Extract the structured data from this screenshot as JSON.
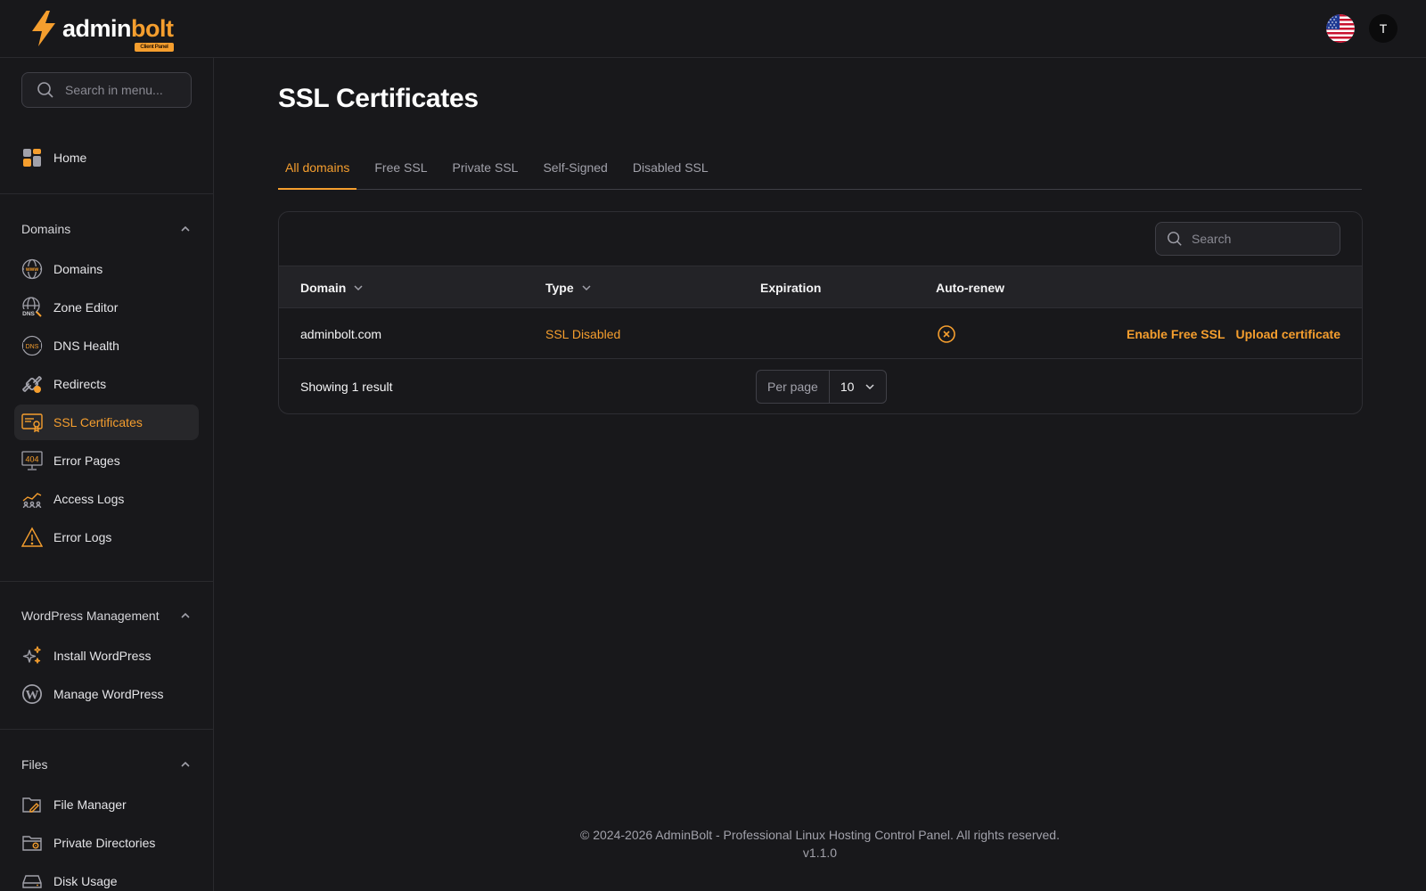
{
  "brand": {
    "name_white": "admin",
    "name_orange": "bolt",
    "badge": "Client Panel"
  },
  "topbar": {
    "avatar_initial": "T",
    "flag_icon": "us-flag-icon"
  },
  "sidebar": {
    "search_placeholder": "Search in menu...",
    "home": {
      "label": "Home",
      "icon": "home-grid-icon"
    },
    "groups": [
      {
        "title": "Domains",
        "items": [
          {
            "label": "Domains",
            "icon": "www-globe-icon"
          },
          {
            "label": "Zone Editor",
            "icon": "dns-globe-icon"
          },
          {
            "label": "DNS Health",
            "icon": "dns-shield-icon"
          },
          {
            "label": "Redirects",
            "icon": "link-icon"
          },
          {
            "label": "SSL Certificates",
            "icon": "certificate-icon",
            "active": true
          },
          {
            "label": "Error Pages",
            "icon": "404-monitor-icon"
          },
          {
            "label": "Access Logs",
            "icon": "chart-people-icon"
          },
          {
            "label": "Error Logs",
            "icon": "warning-triangle-icon"
          }
        ]
      },
      {
        "title": "WordPress Management",
        "items": [
          {
            "label": "Install WordPress",
            "icon": "sparkles-icon"
          },
          {
            "label": "Manage WordPress",
            "icon": "wordpress-icon"
          }
        ]
      },
      {
        "title": "Files",
        "items": [
          {
            "label": "File Manager",
            "icon": "folder-edit-icon"
          },
          {
            "label": "Private Directories",
            "icon": "folder-lock-icon"
          },
          {
            "label": "Disk Usage",
            "icon": "hard-drive-icon"
          }
        ]
      }
    ]
  },
  "page": {
    "title": "SSL Certificates",
    "tabs": [
      "All domains",
      "Free SSL",
      "Private SSL",
      "Self-Signed",
      "Disabled SSL"
    ],
    "active_tab": 0
  },
  "table": {
    "search_placeholder": "Search",
    "columns": [
      "Domain",
      "Type",
      "Expiration",
      "Auto-renew"
    ],
    "rows": [
      {
        "domain": "adminbolt.com",
        "type": "SSL Disabled",
        "expiration": "",
        "auto_renew_icon": "x-circle-icon",
        "actions": [
          "Enable Free SSL",
          "Upload certificate"
        ]
      }
    ],
    "result_text": "Showing 1 result",
    "per_page_label": "Per page",
    "per_page_value": "10"
  },
  "footer": {
    "copyright": "© 2024-2026 AdminBolt - Professional Linux Hosting Control Panel. All rights reserved.",
    "version": "v1.1.0"
  },
  "colors": {
    "accent": "#f59e2e",
    "background": "#18181b",
    "sidebar_active": "#27272a"
  }
}
